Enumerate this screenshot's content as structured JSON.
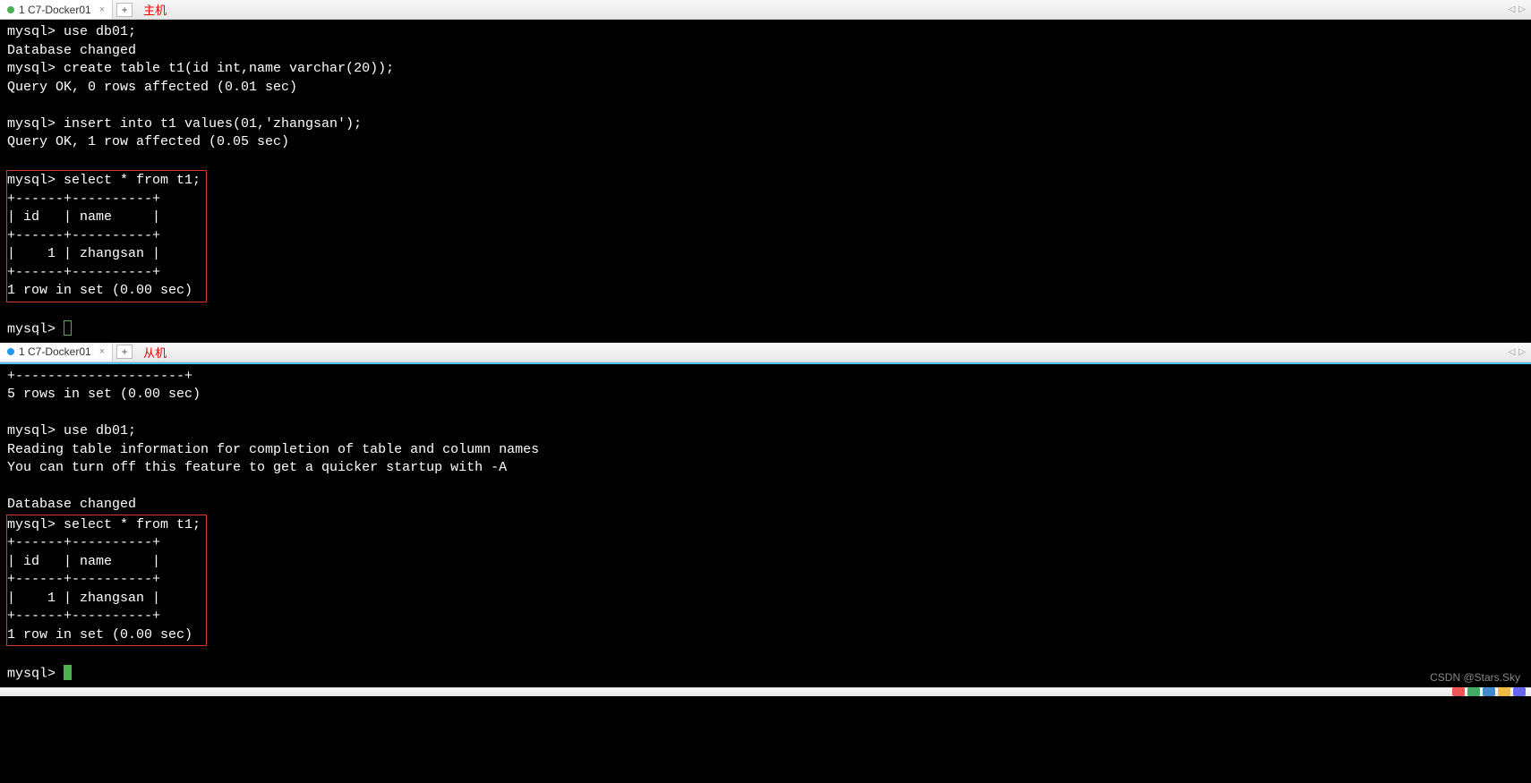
{
  "top": {
    "tab_title": "1 C7-Docker01",
    "add_tab": "+",
    "label_cn": "主机",
    "nav_left": "◁",
    "nav_right": "▷",
    "lines_before_box": "mysql> use db01;\nDatabase changed\nmysql> create table t1(id int,name varchar(20));\nQuery OK, 0 rows affected (0.01 sec)\n\nmysql> insert into t1 values(01,'zhangsan');\nQuery OK, 1 row affected (0.05 sec)\n",
    "boxed": "mysql> select * from t1;\n+------+----------+\n| id   | name     |\n+------+----------+\n|    1 | zhangsan |\n+------+----------+\n1 row in set (0.00 sec)",
    "prompt_after": "mysql> "
  },
  "bottom": {
    "tab_title": "1 C7-Docker01",
    "add_tab": "+",
    "label_cn": "从机",
    "nav_left": "◁",
    "nav_right": "▷",
    "lines_before_box": "+---------------------+\n5 rows in set (0.00 sec)\n\nmysql> use db01;\nReading table information for completion of table and column names\nYou can turn off this feature to get a quicker startup with -A\n\nDatabase changed",
    "boxed": "mysql> select * from t1;\n+------+----------+\n| id   | name     |\n+------+----------+\n|    1 | zhangsan |\n+------+----------+\n1 row in set (0.00 sec)",
    "prompt_after": "mysql> "
  },
  "watermark": "CSDN @Stars.Sky"
}
